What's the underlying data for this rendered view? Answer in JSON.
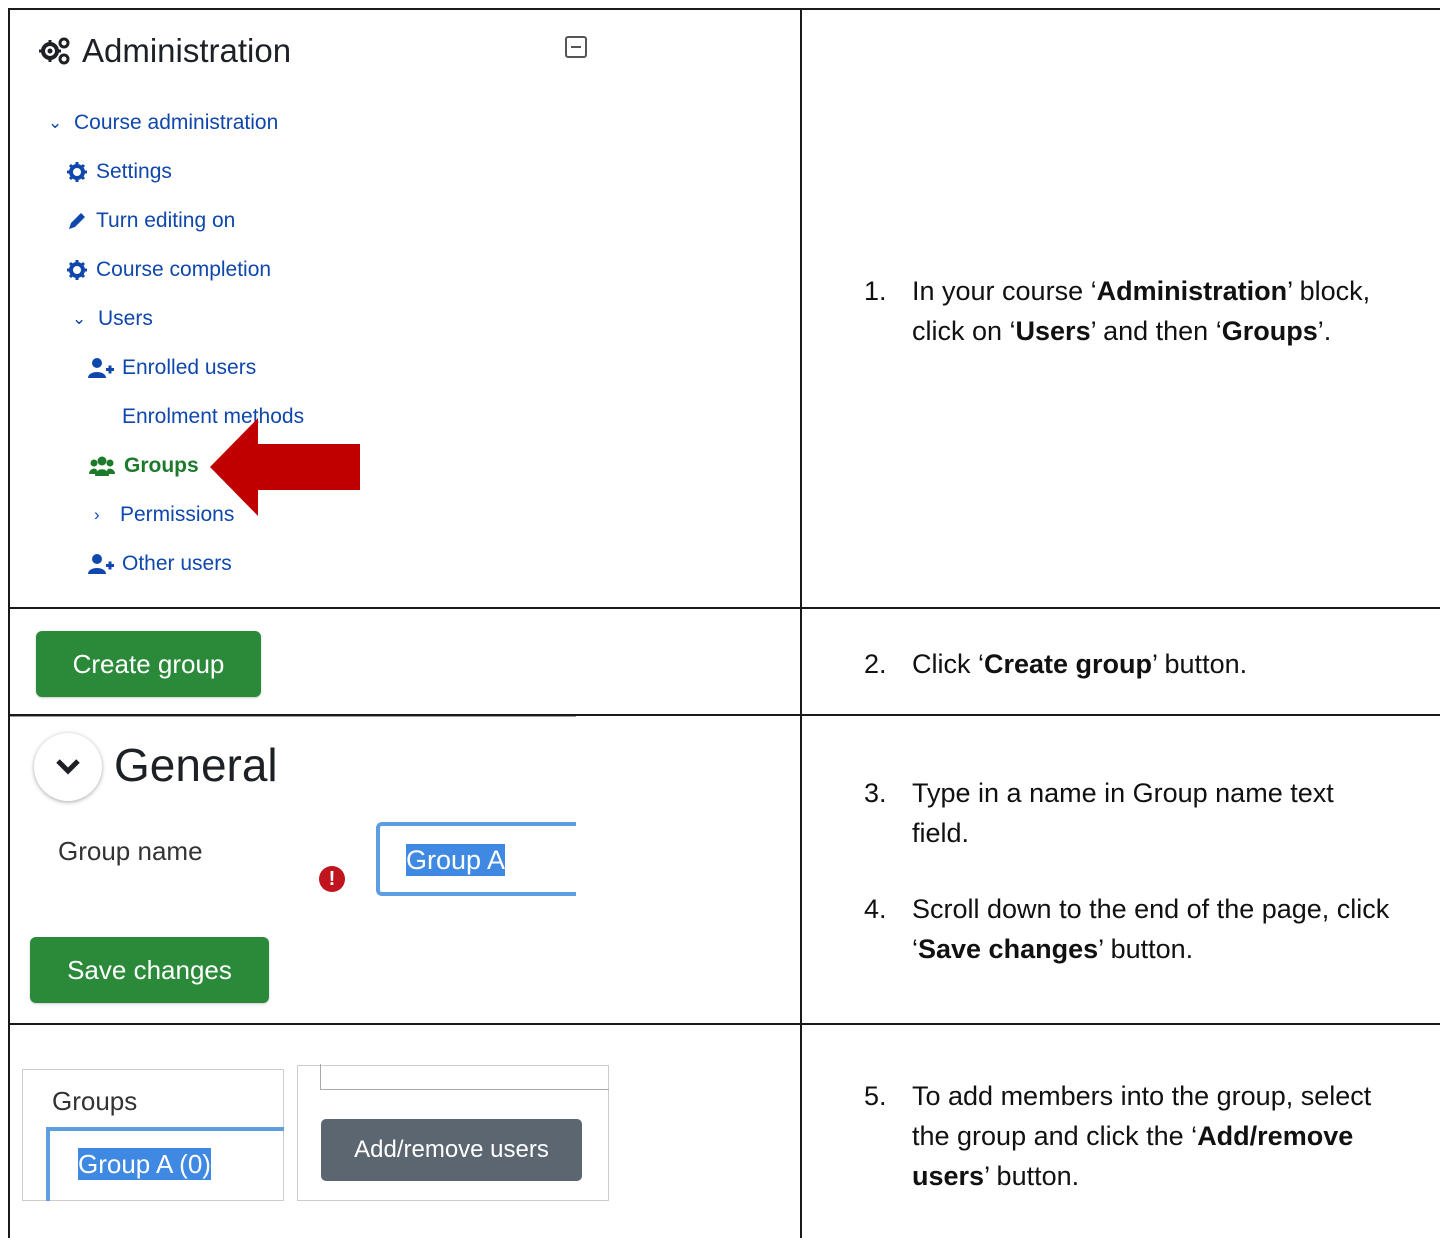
{
  "admin_block": {
    "title": "Administration",
    "course_admin": "Course administration",
    "items": [
      {
        "label": "Settings"
      },
      {
        "label": "Turn editing on"
      },
      {
        "label": "Course completion"
      }
    ],
    "users": "Users",
    "users_items": [
      {
        "label": "Enrolled users"
      },
      {
        "label": "Enrolment methods"
      },
      {
        "label": "Groups"
      },
      {
        "label": "Permissions"
      },
      {
        "label": "Other users"
      }
    ]
  },
  "create_group_button": "Create group",
  "general": {
    "title": "General",
    "group_name_label": "Group name",
    "group_name_value": "Group A",
    "save_button": "Save changes"
  },
  "groups_panel": {
    "label": "Groups",
    "selected": "Group A (0)",
    "add_remove_button": "Add/remove users"
  },
  "colors": {
    "link": "#0f47ad",
    "active": "#1d7a2b",
    "button_green": "#2a8a39",
    "button_dark": "#5c6670",
    "arrow": "#c00000",
    "selection": "#3f89e3"
  },
  "steps": [
    {
      "num": "1.",
      "pre": "In your course ‘",
      "b1": "Administration",
      "mid": "’ block,",
      "line2_pre": "click on ‘",
      "b2": "Users",
      "line2_mid": "’ and then ‘",
      "b3": "Groups",
      "line2_end": "’."
    },
    {
      "num": "2.",
      "pre": "Click ‘",
      "b1": "Create group",
      "end": "’ button."
    },
    {
      "num": "3.",
      "line1": "Type in a name in Group name text",
      "line2": "field."
    },
    {
      "num": "4.",
      "line1": "Scroll down to the end of the page, click",
      "line2_pre": "‘",
      "b1": "Save changes",
      "line2_end": "’ button."
    },
    {
      "num": "5.",
      "line1": "To add members into the group, select",
      "line2_pre": "the group and click the ‘",
      "b1": "Add/remove",
      "line3_b": "users",
      "line3_end": "’ button."
    }
  ]
}
